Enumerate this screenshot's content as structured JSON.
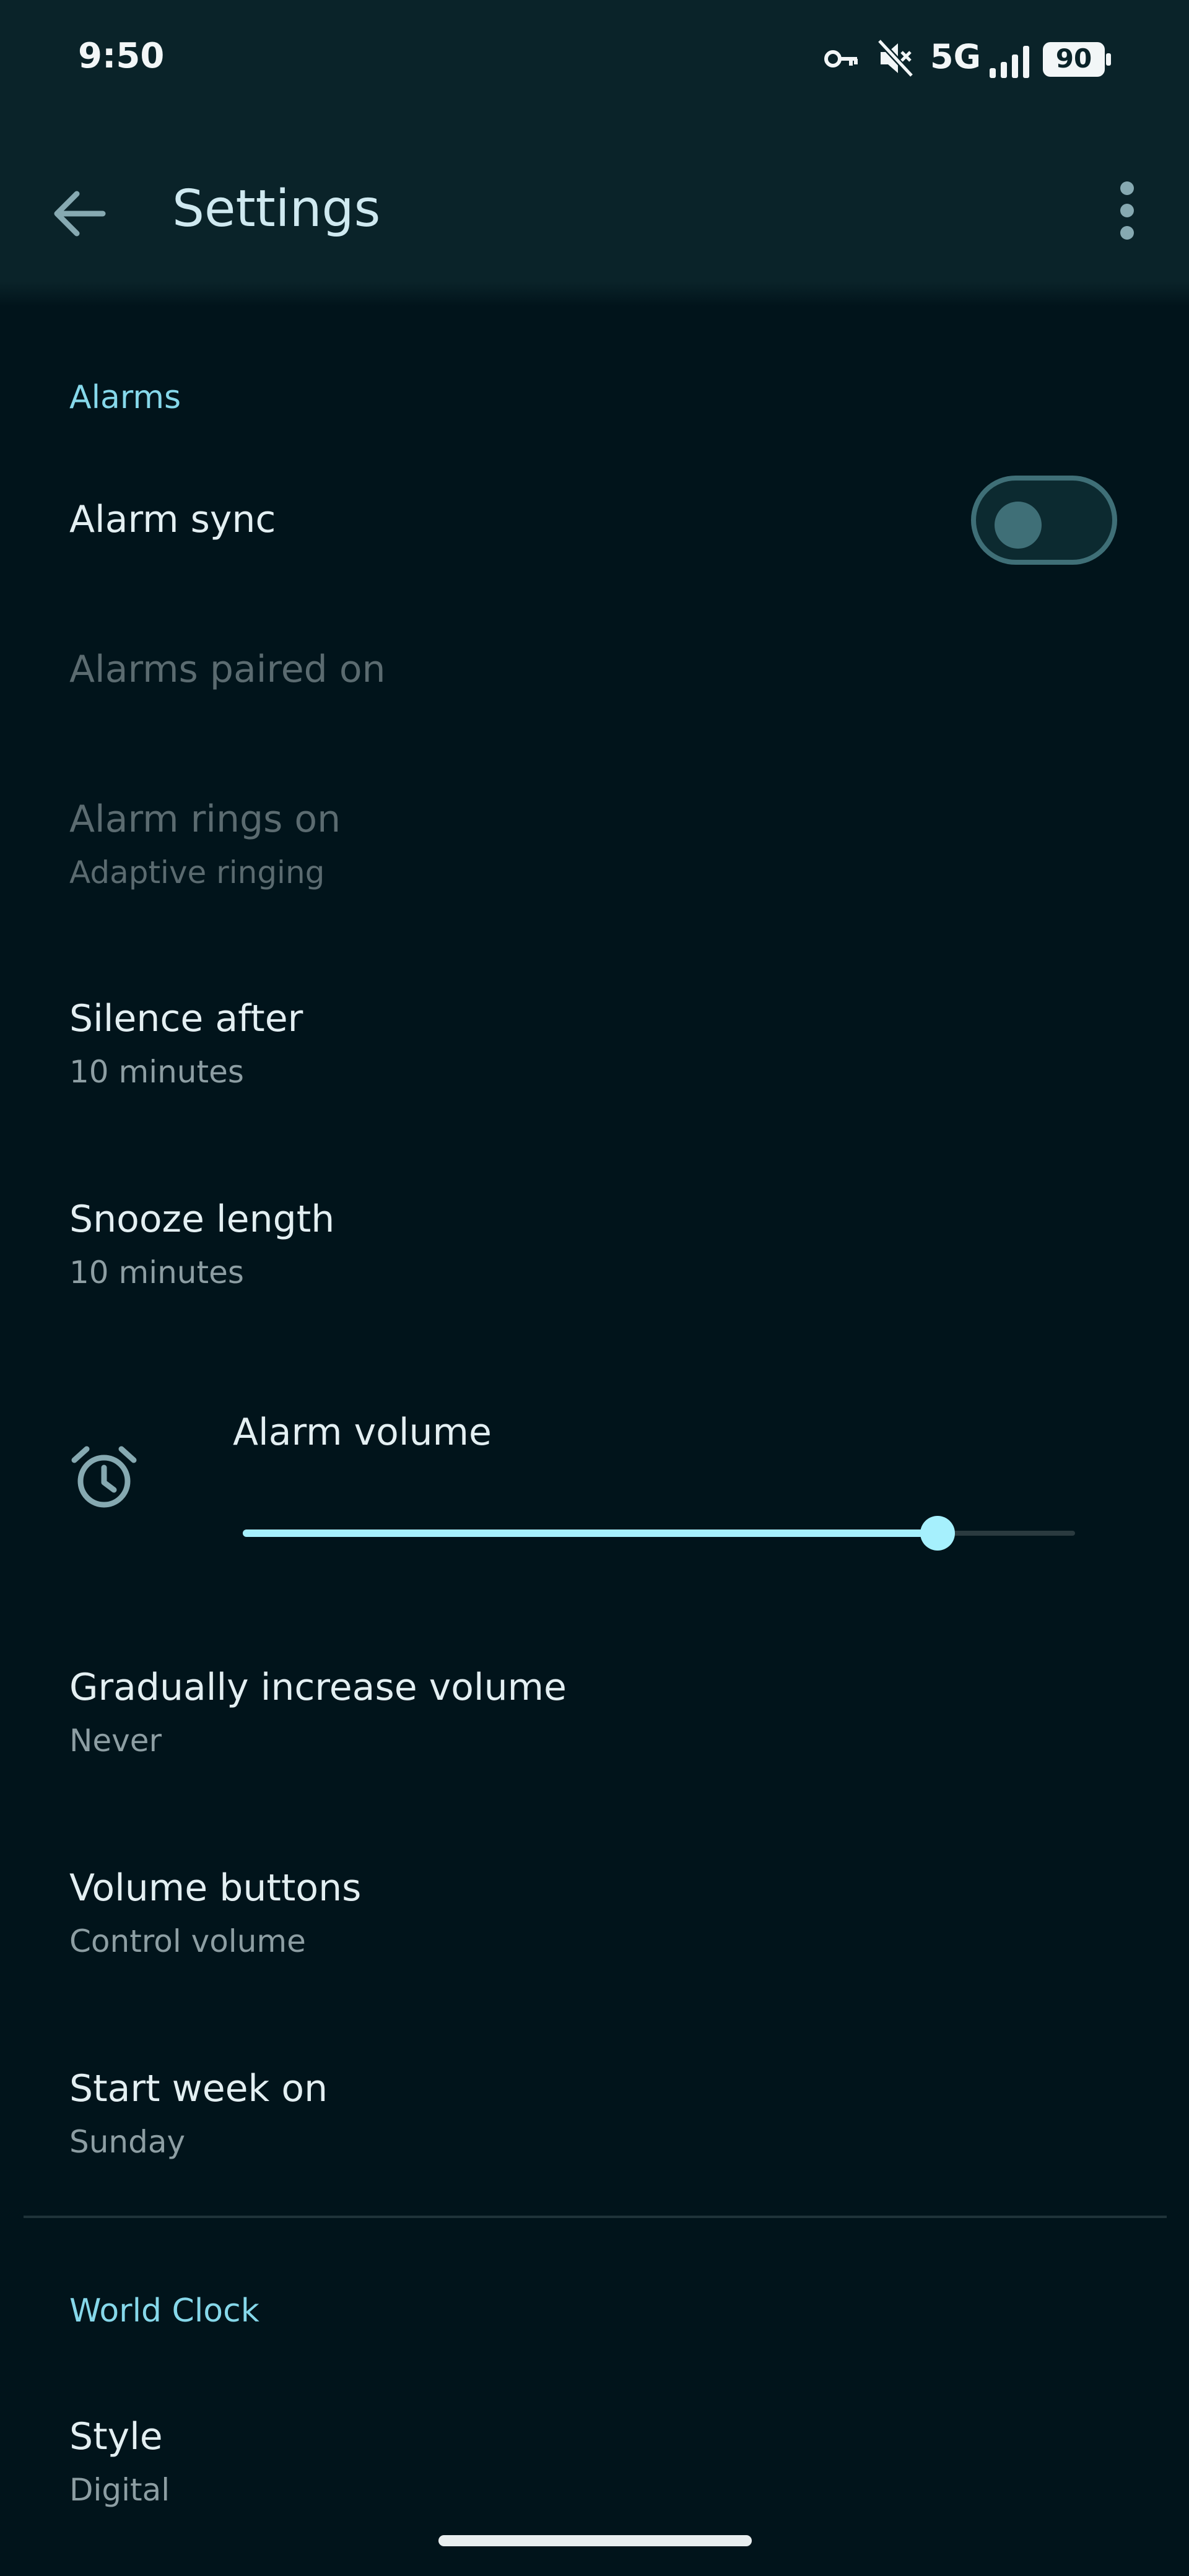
{
  "status_bar": {
    "time": "9:50",
    "network": "5G",
    "battery": "90"
  },
  "app_bar": {
    "title": "Settings"
  },
  "alarms_section": {
    "header": "Alarms",
    "alarm_sync": {
      "title": "Alarm sync",
      "enabled": false
    },
    "alarms_paired_on": {
      "title": "Alarms paired on"
    },
    "alarm_rings_on": {
      "title": "Alarm rings on",
      "summary": "Adaptive ringing"
    },
    "silence_after": {
      "title": "Silence after",
      "summary": "10 minutes"
    },
    "snooze_length": {
      "title": "Snooze length",
      "summary": "10 minutes"
    },
    "alarm_volume": {
      "title": "Alarm volume",
      "level_percent": 83.5
    },
    "gradually_increase": {
      "title": "Gradually increase volume",
      "summary": "Never"
    },
    "volume_buttons": {
      "title": "Volume buttons",
      "summary": "Control volume"
    },
    "start_week": {
      "title": "Start week on",
      "summary": "Sunday"
    }
  },
  "world_clock_section": {
    "header": "World Clock",
    "style": {
      "title": "Style",
      "summary": "Digital"
    }
  },
  "colors": {
    "accent": "#86d8ea",
    "slider_active": "#a6f0fd",
    "background": "#01141b",
    "app_bar": "#0a2329"
  }
}
